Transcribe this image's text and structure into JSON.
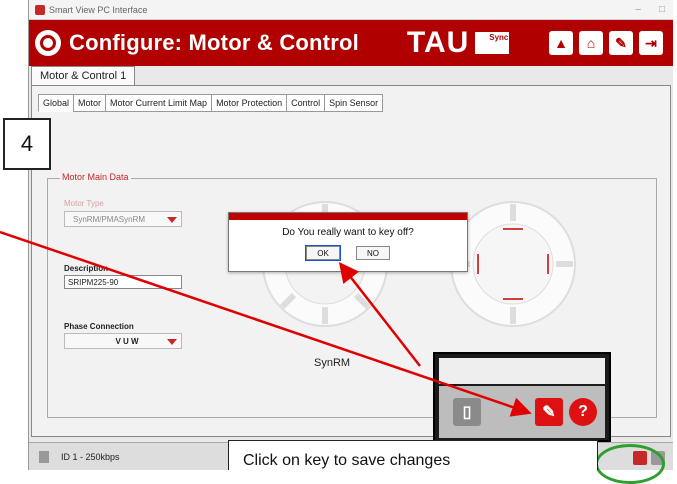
{
  "window": {
    "title": "Smart View PC Interface"
  },
  "header": {
    "title": "Configure: Motor & Control",
    "brand": "TAU",
    "brand_badge": "Sync",
    "buttons": [
      "up-arrow-icon",
      "home-icon",
      "tools-icon",
      "exit-icon"
    ]
  },
  "main_tab": "Motor & Control 1",
  "tabs": [
    "Global",
    "Motor",
    "Motor Current Limit Map",
    "Motor Protection",
    "Control",
    "Spin Sensor"
  ],
  "group": {
    "title": "Motor Main Data",
    "motor_type_label": "Motor Type",
    "motor_type_value": "SynRM/PMASynRM",
    "description_label": "Description",
    "description_value": "SRIPM225-90",
    "phase_label": "Phase Connection",
    "phase_value": "V U W",
    "motor_caption": "SynRM"
  },
  "dialog": {
    "question": "Do You really want to key off?",
    "ok": "OK",
    "no": "NO"
  },
  "status": {
    "text": "ID 1 - 250kbps"
  },
  "annotations": {
    "step": "4",
    "callout": "Click on key to save changes"
  },
  "colors": {
    "brand_red": "#b00000",
    "arrow_red": "#e00000",
    "ring_green": "#2e9e2e"
  }
}
